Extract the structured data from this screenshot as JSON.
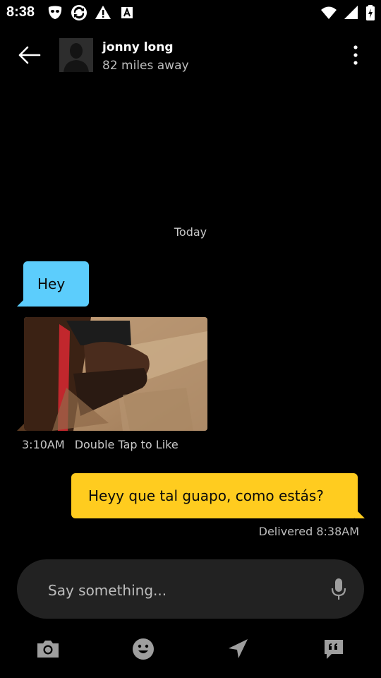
{
  "status_bar": {
    "time": "8:38",
    "left_icons": [
      "grindr-mask-icon",
      "sync-icon",
      "warning-icon",
      "a-box-icon"
    ],
    "right_icons": [
      "wifi-icon",
      "signal-icon",
      "battery-charging-icon"
    ]
  },
  "header": {
    "contact_name": "jonny long",
    "contact_distance": "82 miles away"
  },
  "conversation": {
    "date_separator": "Today",
    "incoming": {
      "text": "Hey",
      "bubble_color": "#5ccdfc"
    },
    "photo_message": {
      "time": "3:10AM",
      "like_hint": "Double Tap to Like"
    },
    "outgoing": {
      "text": "Heyy que tal guapo, como estás?",
      "bubble_color": "#ffcc1f",
      "status": "Delivered 8:38AM"
    }
  },
  "composer": {
    "placeholder": "Say something..."
  },
  "bottom_bar": {
    "items": [
      "camera-icon",
      "emoji-icon",
      "location-arrow-icon",
      "saved-phrases-icon"
    ]
  }
}
